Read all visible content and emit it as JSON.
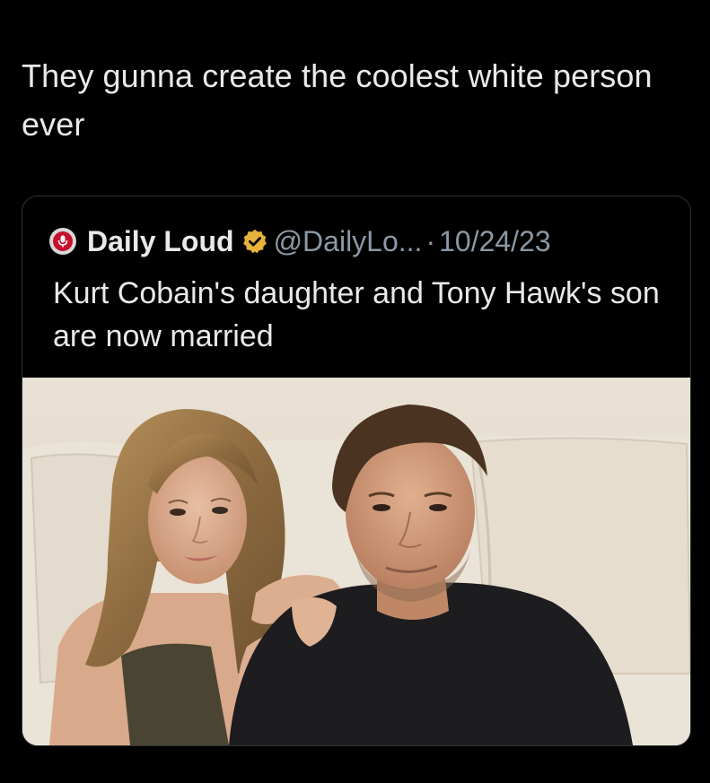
{
  "post": {
    "text": "They gunna create the coolest white person ever"
  },
  "quoted": {
    "name": "Daily Loud",
    "handle": "@DailyLo...",
    "separator": "·",
    "date": "10/24/23",
    "text": "Kurt Cobain's daughter and Tony Hawk's son are now married"
  },
  "colors": {
    "background": "#000000",
    "text": "#e7e9ea",
    "muted": "#8b98a5",
    "verified_badge": "#e8b33a",
    "card_border": "#2f3336"
  },
  "icons": {
    "avatar": "daily-loud-logo-icon",
    "verified": "verified-badge-icon"
  }
}
